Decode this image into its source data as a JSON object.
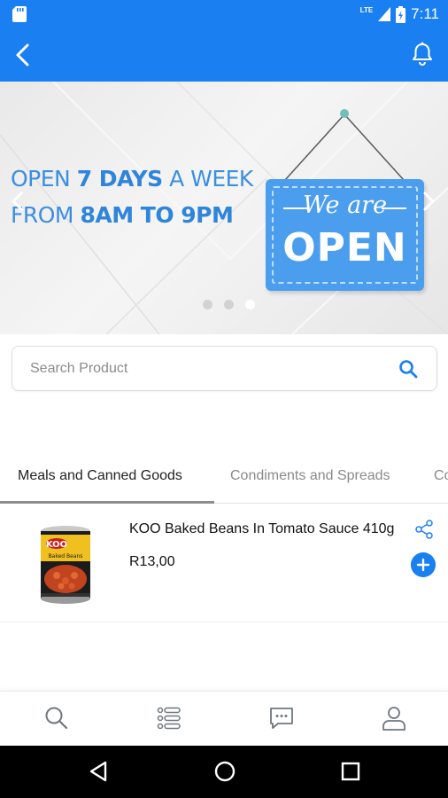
{
  "status_bar": {
    "time": "7:11",
    "network": "LTE",
    "icons": [
      "sd-card-icon",
      "signal-icon",
      "battery-icon"
    ]
  },
  "app_bar": {
    "color": "#1a7ff0",
    "icons": [
      "back-arrow-icon",
      "bell-icon"
    ]
  },
  "banner": {
    "line1_prefix": "OPEN ",
    "line1_bold": "7 DAYS",
    "line1_suffix": " A WEEK",
    "line2_prefix": "FROM ",
    "line2_bold": "8AM TO 9PM",
    "sign_top": "We are",
    "sign_main": "OPEN",
    "slide_count": 3,
    "active_slide": 3
  },
  "search": {
    "placeholder": "Search Product",
    "value": ""
  },
  "tabs": [
    {
      "label": "Meals and Canned Goods",
      "active": true
    },
    {
      "label": "Condiments and Spreads",
      "active": false
    },
    {
      "label": "Co",
      "active": false
    }
  ],
  "products": [
    {
      "name": "KOO Baked Beans In Tomato Sauce 410g",
      "price": "R13,00",
      "image": "canned-beans-image",
      "brand_on_label": "KOO"
    }
  ],
  "bottom_nav": [
    {
      "icon": "search-icon"
    },
    {
      "icon": "categories-list-icon"
    },
    {
      "icon": "chat-icon"
    },
    {
      "icon": "profile-icon"
    }
  ],
  "system_nav": [
    "back-triangle-icon",
    "home-circle-icon",
    "recents-square-icon"
  ],
  "colors": {
    "primary": "#1a7ff0",
    "banner_text": "#3b8fe0",
    "sign": "#4b9dee"
  }
}
